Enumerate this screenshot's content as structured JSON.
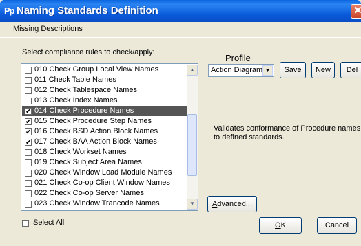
{
  "window": {
    "title": "Naming Standards Definition",
    "app_icon": "Pp",
    "close_icon": "close-icon"
  },
  "menu": {
    "items": [
      {
        "mnemonic": "M",
        "rest": "issing Descriptions"
      }
    ]
  },
  "rules_prompt": "Select compliance rules to check/apply:",
  "rules": [
    {
      "label": "010 Check Group Local View Names",
      "checked": false,
      "selected": false
    },
    {
      "label": "011 Check Table Names",
      "checked": false,
      "selected": false
    },
    {
      "label": "012 Check Tablespace Names",
      "checked": false,
      "selected": false
    },
    {
      "label": "013 Check Index Names",
      "checked": false,
      "selected": false
    },
    {
      "label": "014 Check Procedure Names",
      "checked": true,
      "selected": true
    },
    {
      "label": "015 Check Procedure Step Names",
      "checked": true,
      "selected": false
    },
    {
      "label": "016 Check BSD Action Block Names",
      "checked": true,
      "selected": false
    },
    {
      "label": "017 Check BAA Action Block Names",
      "checked": true,
      "selected": false
    },
    {
      "label": "018 Check Workset Names",
      "checked": false,
      "selected": false
    },
    {
      "label": "019 Check Subject Area Names",
      "checked": false,
      "selected": false
    },
    {
      "label": "020 Check Window Load Module Names",
      "checked": false,
      "selected": false
    },
    {
      "label": "021 Check Co-op Client Window Names",
      "checked": false,
      "selected": false
    },
    {
      "label": "022 Check Co-op Server Names",
      "checked": false,
      "selected": false
    },
    {
      "label": "023 Check Window Trancode Names",
      "checked": false,
      "selected": false
    }
  ],
  "select_all": {
    "label": "Select All",
    "checked": false
  },
  "profile": {
    "label": "Profile",
    "selected_value": "Action Diagram",
    "save_label": "Save",
    "new_label": "New",
    "del_label": "Del"
  },
  "description": "Validates conformance of Procedure names to defined standards.",
  "advanced": {
    "mnemonic": "A",
    "rest": "dvanced..."
  },
  "ok": {
    "mnemonic": "O",
    "rest": "K"
  },
  "cancel_label": "Cancel"
}
